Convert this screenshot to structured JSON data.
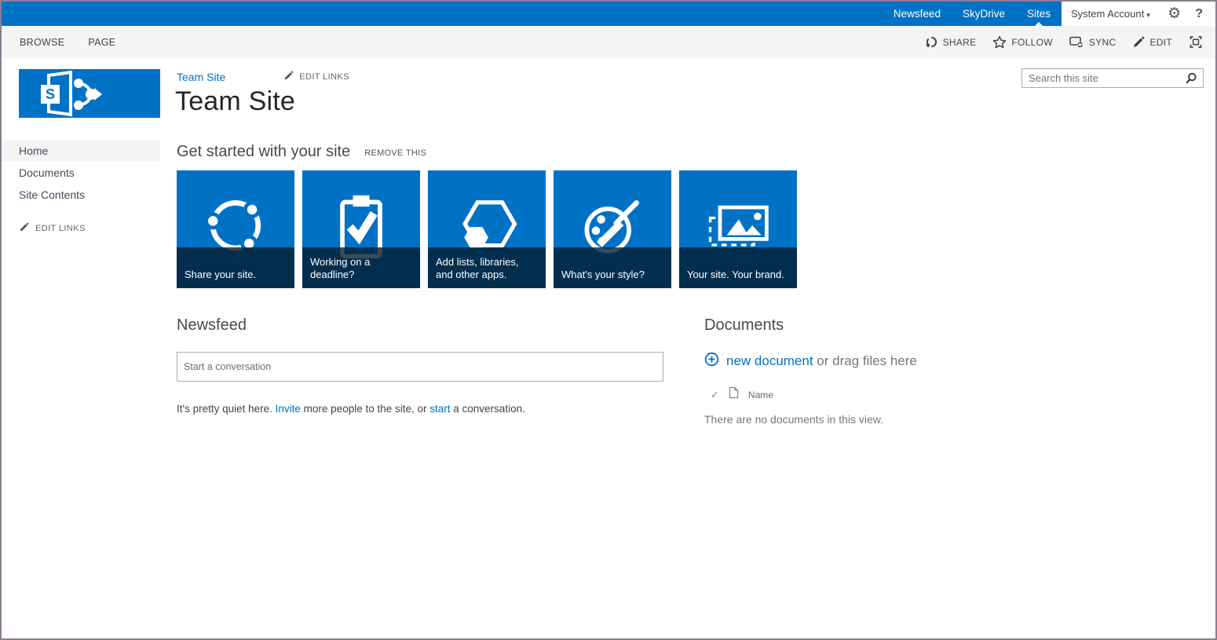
{
  "suite_bar": {
    "links": [
      "Newsfeed",
      "SkyDrive",
      "Sites"
    ],
    "active_link": "Sites",
    "account_label": "System Account",
    "help_label": "?",
    "bar_color": "#0072c6"
  },
  "ribbon": {
    "tabs": [
      "BROWSE",
      "PAGE"
    ],
    "actions": [
      "SHARE",
      "FOLLOW",
      "SYNC",
      "EDIT"
    ]
  },
  "header": {
    "breadcrumb": "Team Site",
    "edit_links_label": "EDIT LINKS",
    "title": "Team Site",
    "search": {
      "placeholder": "Search this site"
    }
  },
  "sidebar": {
    "items": [
      {
        "label": "Home",
        "selected": true
      },
      {
        "label": "Documents",
        "selected": false
      },
      {
        "label": "Site Contents",
        "selected": false
      }
    ],
    "edit_links_label": "EDIT LINKS"
  },
  "getting_started": {
    "title": "Get started with your site",
    "remove_label": "REMOVE THIS",
    "tile_color": "#0072c6",
    "caption_color": "#0b2a47",
    "tiles": [
      {
        "label": "Share your site.",
        "icon": "share-circle-icon"
      },
      {
        "label": "Working on a deadline?",
        "icon": "clipboard-check-icon"
      },
      {
        "label": "Add lists, libraries, and other apps.",
        "icon": "apps-hexagon-icon"
      },
      {
        "label": "What's your style?",
        "icon": "style-palette-icon"
      },
      {
        "label": "Your site. Your brand.",
        "icon": "brand-picture-icon"
      }
    ]
  },
  "newsfeed": {
    "title": "Newsfeed",
    "input_placeholder": "Start a conversation",
    "quiet": {
      "t1": "It's pretty quiet here. ",
      "invite_link": "Invite",
      "t2": " more people to the site, or ",
      "start_link": "start",
      "t3": " a conversation."
    }
  },
  "documents": {
    "title": "Documents",
    "new_link": "new document",
    "drag_text": " or drag files here",
    "name_header": "Name",
    "empty_text": "There are no documents in this view."
  },
  "colors": {
    "accent": "#0072c6",
    "link": "#0072c6"
  }
}
